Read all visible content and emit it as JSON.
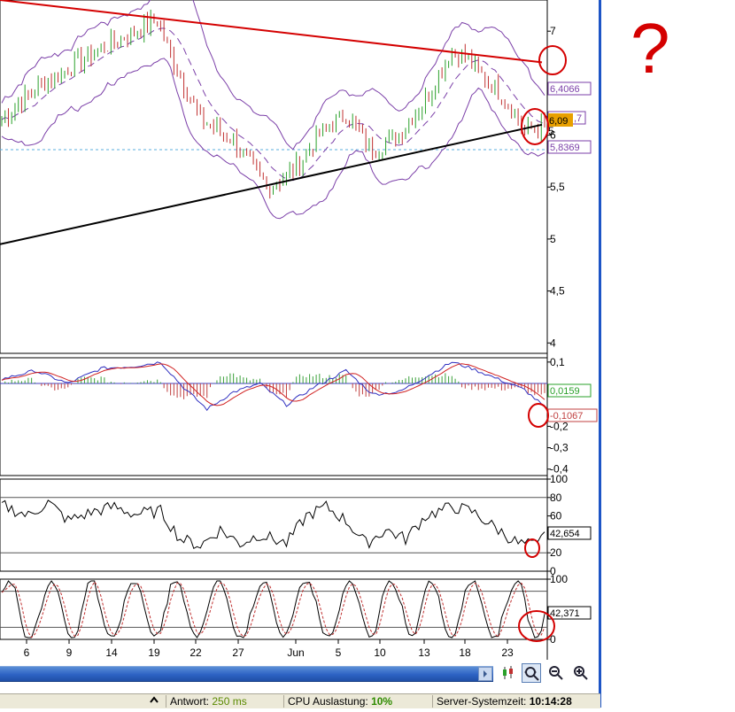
{
  "chart_data": [
    {
      "type": "line",
      "title": "",
      "ylim": [
        3.9,
        7.3
      ],
      "y_ticks": [
        "7",
        "6",
        "5,5",
        "5",
        "4,5",
        "4"
      ],
      "y_tick_values": [
        7,
        6,
        5.5,
        5,
        4.5,
        4
      ],
      "value_boxes": [
        {
          "label": "6,4066",
          "color": "#7b3fa8"
        },
        {
          "label": "6,09",
          "color": "#e8a000"
        },
        {
          "label": ",7",
          "color": "#7b3fa8"
        },
        {
          "label": "5,8369",
          "color": "#7b3fa8"
        }
      ],
      "partial_labels": [
        "5"
      ],
      "trendlines": [
        {
          "color": "#d40000",
          "from": [
            0,
            7.3
          ],
          "to": [
            1,
            6.7
          ]
        },
        {
          "color": "#000000",
          "from": [
            0,
            4.95
          ],
          "to": [
            1,
            6.1
          ]
        }
      ],
      "reference_level": 5.86
    },
    {
      "type": "line",
      "ylim": [
        -0.43,
        0.12
      ],
      "y_ticks": [
        "0,1",
        "-0,2",
        "-0,3",
        "-0,4"
      ],
      "y_tick_values": [
        0.1,
        -0.2,
        -0.3,
        -0.4
      ],
      "value_boxes": [
        {
          "label": "0,0159",
          "color": "#2aa02a"
        },
        {
          "label": "-0,1067",
          "color": "#c04040"
        }
      ]
    },
    {
      "type": "line",
      "ylim": [
        0,
        100
      ],
      "y_ticks": [
        "100",
        "80",
        "60",
        "20",
        "0"
      ],
      "y_tick_values": [
        100,
        80,
        60,
        20,
        0
      ],
      "value_boxes": [
        {
          "label": "42,654",
          "color": "#000000"
        }
      ]
    },
    {
      "type": "line",
      "ylim": [
        0,
        100
      ],
      "y_ticks": [
        "100",
        "0"
      ],
      "y_tick_values": [
        100,
        0
      ],
      "value_boxes": [
        {
          "label": "42,371",
          "color": "#000000"
        }
      ]
    }
  ],
  "x_axis": {
    "ticks": [
      "6",
      "9",
      "14",
      "19",
      "22",
      "27",
      "Jun",
      "5",
      "10",
      "13",
      "18",
      "23"
    ]
  },
  "annotation": {
    "question_mark": "?"
  },
  "status": {
    "antwort_label": "Antwort:",
    "antwort_value": "250 ms",
    "cpu_label": "CPU Auslastung:",
    "cpu_value": "10%",
    "server_label": "Server-Systemzeit:",
    "server_value": "10:14:28"
  },
  "colors": {
    "price_up": "#2aa02a",
    "price_down": "#c03030",
    "bollinger": "#7b3fa8",
    "annotation_red": "#d40000"
  }
}
